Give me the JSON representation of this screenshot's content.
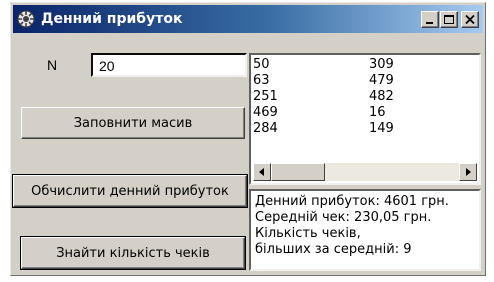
{
  "window": {
    "title": "Денний прибуток",
    "minimize_label": "_",
    "maximize_label": "□",
    "close_label": "×"
  },
  "form": {
    "n_label": "N",
    "n_value": "20",
    "fill_button": "Заповнити масив",
    "calc_button": "Обчислити денний прибуток",
    "count_button": "Знайти кількість чеків"
  },
  "list": {
    "rows": [
      [
        "50",
        "309"
      ],
      [
        "63",
        "479"
      ],
      [
        "251",
        "482"
      ],
      [
        "469",
        "16"
      ],
      [
        "284",
        "149"
      ]
    ]
  },
  "result": {
    "lines": [
      "Денний прибуток: 4601 грн.",
      "Середній чек: 230,05 грн.",
      "Кількість чеків,",
      "більших за середній: 9"
    ]
  },
  "icons": {
    "app": "gear-icon",
    "scroll_left": "arrow-left-icon",
    "scroll_right": "arrow-right-icon"
  },
  "colors": {
    "titlebar_start": "#0a246a",
    "titlebar_end": "#a6caf0",
    "window_bg": "#d4d0c8"
  }
}
